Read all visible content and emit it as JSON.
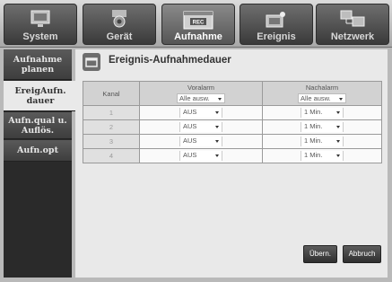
{
  "tabs": [
    {
      "label": "System",
      "icon": "monitor-icon"
    },
    {
      "label": "Gerät",
      "icon": "camera-icon"
    },
    {
      "label": "Aufnahme",
      "icon": "rec-icon",
      "badge": "REC"
    },
    {
      "label": "Ereignis",
      "icon": "event-icon"
    },
    {
      "label": "Netzwerk",
      "icon": "network-icon"
    }
  ],
  "sidebar": {
    "items": [
      {
        "label": "Aufnahme planen"
      },
      {
        "label": "EreigAufn. dauer"
      },
      {
        "label": "Aufn.qual u. Auflös."
      },
      {
        "label": "Aufn.opt"
      }
    ]
  },
  "main": {
    "title": "Ereignis-Aufnahmedauer",
    "columns": {
      "kanal": "Kanal",
      "voralarm": "Voralarm",
      "voralarm_all": "Alle ausw.",
      "nachalarm": "Nachalarm",
      "nachalarm_all": "Alle ausw."
    },
    "rows": [
      {
        "kanal": "1",
        "voralarm": "AUS",
        "nachalarm": "1 Min."
      },
      {
        "kanal": "2",
        "voralarm": "AUS",
        "nachalarm": "1 Min."
      },
      {
        "kanal": "3",
        "voralarm": "AUS",
        "nachalarm": "1 Min."
      },
      {
        "kanal": "4",
        "voralarm": "AUS",
        "nachalarm": "1 Min."
      }
    ],
    "buttons": {
      "apply": "Übern.",
      "cancel": "Abbruch"
    }
  },
  "colors": {
    "tab_active": "#555555",
    "panel_bg": "#e9e9e9",
    "sidebar_bg": "#2a2a2a"
  }
}
